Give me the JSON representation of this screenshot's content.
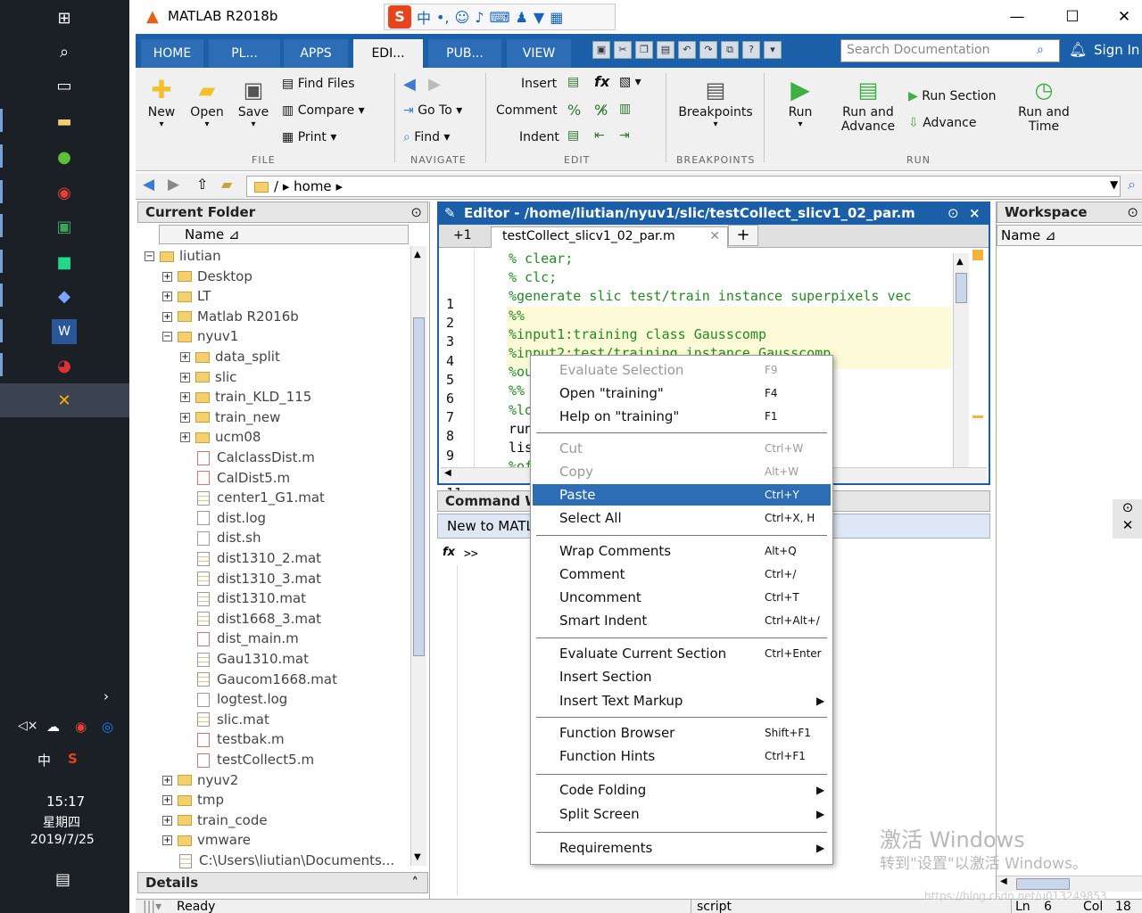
{
  "taskbar": {
    "clock_time": "15:17",
    "clock_day": "星期四",
    "clock_date": "2019/7/25",
    "ime_lang": "中",
    "ime_logo": "S"
  },
  "window": {
    "title": "MATLAB R2018b",
    "ime_lang": "中",
    "ime_logo": "S"
  },
  "tabs": [
    {
      "label": "HOME"
    },
    {
      "label": "PL..."
    },
    {
      "label": "APPS"
    },
    {
      "label": "EDI..."
    },
    {
      "label": "PUB..."
    },
    {
      "label": "VIEW"
    }
  ],
  "search_placeholder": "Search Documentation",
  "sign_in": "Sign In",
  "ribbon": {
    "new": "New",
    "open": "Open",
    "save": "Save",
    "find_files": "Find Files",
    "compare": "Compare",
    "print": "Print",
    "go_to": "Go To",
    "find": "Find",
    "insert": "Insert",
    "comment": "Comment",
    "indent": "Indent",
    "breakpoints": "Breakpoints",
    "run": "Run",
    "run_and_advance_1": "Run and",
    "run_and_advance_2": "Advance",
    "run_section": "Run Section",
    "advance": "Advance",
    "run_and_time_1": "Run and",
    "run_and_time_2": "Time",
    "sections": {
      "file": "FILE",
      "navigate": "NAVIGATE",
      "edit": "EDIT",
      "breakpoints": "BREAKPOINTS",
      "run": "RUN"
    }
  },
  "address": {
    "sep": "/",
    "folder": "home"
  },
  "current_folder": {
    "title": "Current Folder",
    "name_col": "Name",
    "items": [
      {
        "label": "liutian",
        "kind": "folder",
        "exp": "−"
      },
      {
        "label": "Desktop",
        "kind": "folder",
        "exp": "+"
      },
      {
        "label": "LT",
        "kind": "folder",
        "exp": "+"
      },
      {
        "label": "Matlab R2016b",
        "kind": "folder",
        "exp": "+"
      },
      {
        "label": "nyuv1",
        "kind": "folder",
        "exp": "−"
      },
      {
        "label": "data_split",
        "kind": "folder",
        "exp": "+"
      },
      {
        "label": "slic",
        "kind": "folder",
        "exp": "+"
      },
      {
        "label": "train_KLD_115",
        "kind": "folder",
        "exp": "+"
      },
      {
        "label": "train_new",
        "kind": "folder",
        "exp": "+"
      },
      {
        "label": "ucm08",
        "kind": "folder",
        "exp": "+"
      },
      {
        "label": "CalclassDist.m",
        "kind": "m"
      },
      {
        "label": "CalDist5.m",
        "kind": "m"
      },
      {
        "label": "center1_G1.mat",
        "kind": "mat"
      },
      {
        "label": "dist.log",
        "kind": "file"
      },
      {
        "label": "dist.sh",
        "kind": "file"
      },
      {
        "label": "dist1310_2.mat",
        "kind": "mat"
      },
      {
        "label": "dist1310_3.mat",
        "kind": "mat"
      },
      {
        "label": "dist1310.mat",
        "kind": "mat"
      },
      {
        "label": "dist1668_3.mat",
        "kind": "mat"
      },
      {
        "label": "dist_main.m",
        "kind": "m"
      },
      {
        "label": "Gau1310.mat",
        "kind": "mat"
      },
      {
        "label": "Gaucom1668.mat",
        "kind": "mat"
      },
      {
        "label": "logtest.log",
        "kind": "file"
      },
      {
        "label": "slic.mat",
        "kind": "mat"
      },
      {
        "label": "testbak.m",
        "kind": "m"
      },
      {
        "label": "testCollect5.m",
        "kind": "m"
      },
      {
        "label": "nyuv2",
        "kind": "folder",
        "exp": "+"
      },
      {
        "label": "tmp",
        "kind": "folder",
        "exp": "+"
      },
      {
        "label": "train_code",
        "kind": "folder",
        "exp": "+"
      },
      {
        "label": "vmware",
        "kind": "folder",
        "exp": "+"
      },
      {
        "label": "C:\\Users\\liutian\\Documents...",
        "kind": "mat"
      }
    ],
    "details": "Details"
  },
  "editor": {
    "title": "Editor - /home/liutian/nyuv1/slic/testCollect_slicv1_02_par.m",
    "tab_label": "testCollect_slicv1_02_par.m",
    "tab_count": "+1",
    "new_tab": "+",
    "close": "×",
    "lines": [
      {
        "n": "1",
        "mark": "",
        "text": "% clear;",
        "green": true
      },
      {
        "n": "2",
        "mark": "",
        "text": "% clc;",
        "green": true
      },
      {
        "n": "3",
        "mark": "",
        "text": "%generate slic test/train instance superpixels vec",
        "green": true
      },
      {
        "n": "4",
        "mark": "",
        "text": "%%",
        "green": true
      },
      {
        "n": "5",
        "mark": "",
        "text": "%input1:training class Gausscomp",
        "green": true
      },
      {
        "n": "6",
        "mark": "",
        "text": "%input2:test/training instance Gausscomp",
        "green": true
      },
      {
        "n": "7",
        "mark": "",
        "text": "%output: vectorize",
        "green": true
      },
      {
        "n": "8",
        "mark": "",
        "text": "%%",
        "green": true
      },
      {
        "n": "9",
        "mark": "",
        "text": "%load('./train_200",
        "green": true
      },
      {
        "n": "10",
        "mark": "-",
        "text": "run_piece = num2st",
        "green": false
      },
      {
        "n": "11",
        "mark": "-",
        "text": "listdir = ['' run_",
        "green": false
      },
      {
        "n": "12",
        "mark": "-",
        "text": "%offical test list",
        "green": true
      }
    ]
  },
  "command_window": {
    "title": "Command Window",
    "banner": "New to MATLAB? See resources",
    "prompt": ">>",
    "fx": "fx"
  },
  "workspace": {
    "title": "Workspace",
    "name_col": "Name"
  },
  "context_menu": [
    {
      "label": "Evaluate Selection",
      "shortcut": "F9",
      "disabled": true
    },
    {
      "label": "Open \"training\"",
      "shortcut": "F4"
    },
    {
      "label": "Help on \"training\"",
      "shortcut": "F1"
    },
    {
      "sep": true
    },
    {
      "label": "Cut",
      "shortcut": "Ctrl+W",
      "disabled": true
    },
    {
      "label": "Copy",
      "shortcut": "Alt+W",
      "disabled": true
    },
    {
      "label": "Paste",
      "shortcut": "Ctrl+Y",
      "selected": true
    },
    {
      "label": "Select All",
      "shortcut": "Ctrl+X, H"
    },
    {
      "sep": true
    },
    {
      "label": "Wrap Comments",
      "shortcut": "Alt+Q"
    },
    {
      "label": "Comment",
      "shortcut": "Ctrl+/"
    },
    {
      "label": "Uncomment",
      "shortcut": "Ctrl+T"
    },
    {
      "label": "Smart Indent",
      "shortcut": "Ctrl+Alt+/"
    },
    {
      "sep": true
    },
    {
      "label": "Evaluate Current Section",
      "shortcut": "Ctrl+Enter"
    },
    {
      "label": "Insert Section",
      "shortcut": ""
    },
    {
      "label": "Insert Text Markup",
      "shortcut": "",
      "submenu": true
    },
    {
      "sep": true
    },
    {
      "label": "Function Browser",
      "shortcut": "Shift+F1"
    },
    {
      "label": "Function Hints",
      "shortcut": "Ctrl+F1"
    },
    {
      "sep": true
    },
    {
      "label": "Code Folding",
      "shortcut": "",
      "submenu": true
    },
    {
      "label": "Split Screen",
      "shortcut": "",
      "submenu": true
    },
    {
      "sep": true
    },
    {
      "label": "Requirements",
      "shortcut": "",
      "submenu": true
    }
  ],
  "status": {
    "ready": "Ready",
    "mode": "script",
    "ln_label": "Ln",
    "ln": "6",
    "col_label": "Col",
    "col": "18"
  },
  "watermark": {
    "line1": "激活 Windows",
    "line2": "转到\"设置\"以激活 Windows。",
    "url": "https://blog.csdn.net/u013249853"
  },
  "colors": {
    "matlab_blue": "#1a5fa8",
    "selection": "#2c6db5",
    "comment_green": "#228b22"
  }
}
